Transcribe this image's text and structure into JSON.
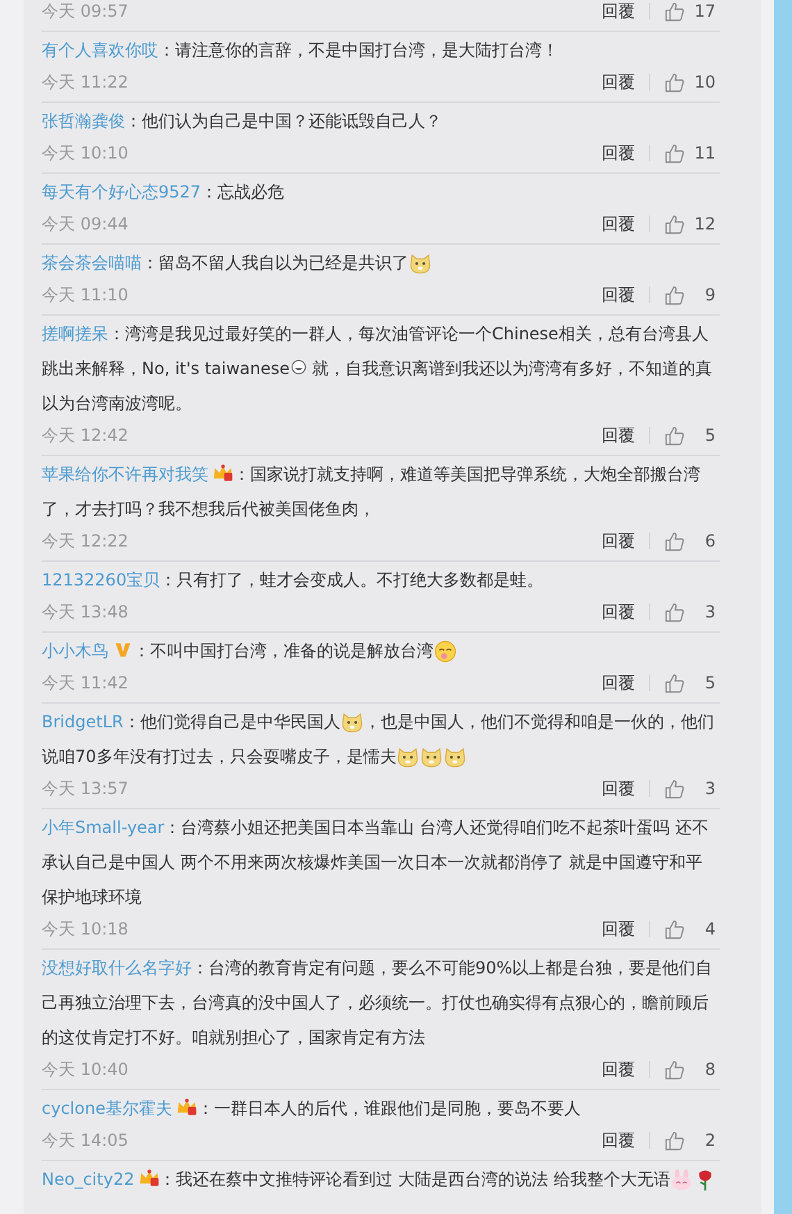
{
  "comments": [
    {
      "time": "今天 09:57",
      "reply": "回覆",
      "likes": "17"
    },
    {
      "user": "有个人喜欢你哎",
      "parts": [
        {
          "kind": "text",
          "text": "：请注意你的言辞，不是中国打台湾，是大陆打台湾！"
        }
      ],
      "time": "今天 11:22",
      "reply": "回覆",
      "likes": "10"
    },
    {
      "user": "张哲瀚龚俊",
      "parts": [
        {
          "kind": "text",
          "text": "：他们认为自己是中国？还能诋毁自己人？"
        }
      ],
      "time": "今天 10:10",
      "reply": "回覆",
      "likes": "11"
    },
    {
      "user": "每天有个好心态9527",
      "parts": [
        {
          "kind": "text",
          "text": "：忘战必危"
        }
      ],
      "time": "今天 09:44",
      "reply": "回覆",
      "likes": "12"
    },
    {
      "user": "茶会茶会喵喵",
      "parts": [
        {
          "kind": "text",
          "text": "：留岛不留人我自以为已经是共识了"
        },
        {
          "kind": "doge"
        }
      ],
      "time": "今天 11:10",
      "reply": "回覆",
      "likes": "9"
    },
    {
      "user": "搓啊搓呆",
      "parts": [
        {
          "kind": "text",
          "text": "：湾湾是我见过最好笑的一群人，每次油管评论一个Chinese相关，总有台湾县人跳出来解释，No, it's taiwanese"
        },
        {
          "kind": "grin"
        },
        {
          "kind": "text",
          "text": " 就，自我意识离谱到我还以为湾湾有多好，不知道的真以为台湾南波湾呢。"
        }
      ],
      "time": "今天 12:42",
      "reply": "回覆",
      "likes": "5"
    },
    {
      "user": "苹果给你不许再对我笑",
      "badge": {
        "kind": "crown"
      },
      "parts": [
        {
          "kind": "text",
          "text": "：国家说打就支持啊，难道等美国把导弹系统，大炮全部搬台湾了，才去打吗？我不想我后代被美国佬鱼肉，"
        }
      ],
      "time": "今天 12:22",
      "reply": "回覆",
      "likes": "6"
    },
    {
      "user": "12132260宝贝",
      "parts": [
        {
          "kind": "text",
          "text": "：只有打了，蛙才会变成人。不打绝大多数都是蛙。"
        }
      ],
      "time": "今天 13:48",
      "reply": "回覆",
      "likes": "3"
    },
    {
      "user": "小小木鸟",
      "badge": {
        "kind": "vip"
      },
      "parts": [
        {
          "kind": "text",
          "text": "：不叫中国打台湾，准备的说是解放台湾"
        },
        {
          "kind": "yum"
        }
      ],
      "time": "今天 11:42",
      "reply": "回覆",
      "likes": "5"
    },
    {
      "user": "BridgetLR",
      "parts": [
        {
          "kind": "text",
          "text": "：他们觉得自己是中华民国人"
        },
        {
          "kind": "doge"
        },
        {
          "kind": "text",
          "text": "，也是中国人，他们不觉得和咱是一伙的，他们说咱70多年没有打过去，只会耍嘴皮子，是懦夫"
        },
        {
          "kind": "doge"
        },
        {
          "kind": "doge"
        },
        {
          "kind": "doge"
        }
      ],
      "time": "今天 13:57",
      "reply": "回覆",
      "likes": "3"
    },
    {
      "user": "小年Small-year",
      "parts": [
        {
          "kind": "text",
          "text": "：台湾蔡小姐还把美国日本当靠山 台湾人还觉得咱们吃不起茶叶蛋吗 还不承认自己是中国人 两个不用来两次核爆炸美国一次日本一次就都消停了 就是中国遵守和平保护地球环境"
        }
      ],
      "time": "今天 10:18",
      "reply": "回覆",
      "likes": "4"
    },
    {
      "user": "没想好取什么名字好",
      "parts": [
        {
          "kind": "text",
          "text": "：台湾的教育肯定有问题，要么不可能90%以上都是台独，要是他们自己再独立治理下去，台湾真的没中国人了，必须统一。打仗也确实得有点狠心的，瞻前顾后的这仗肯定打不好。咱就别担心了，国家肯定有方法"
        }
      ],
      "time": "今天 10:40",
      "reply": "回覆",
      "likes": "8"
    },
    {
      "user": "cyclone基尔霍夫",
      "badge": {
        "kind": "crown"
      },
      "parts": [
        {
          "kind": "text",
          "text": "：一群日本人的后代，谁跟他们是同胞，要岛不要人"
        }
      ],
      "time": "今天 14:05",
      "reply": "回覆",
      "likes": "2"
    },
    {
      "user": "Neo_city22",
      "badge": {
        "kind": "crown"
      },
      "parts": [
        {
          "kind": "text",
          "text": "：我还在蔡中文推特评论看到过 大陆是西台湾的说法 给我整个大无语"
        },
        {
          "kind": "bunny"
        },
        {
          "kind": "rose"
        }
      ]
    }
  ]
}
